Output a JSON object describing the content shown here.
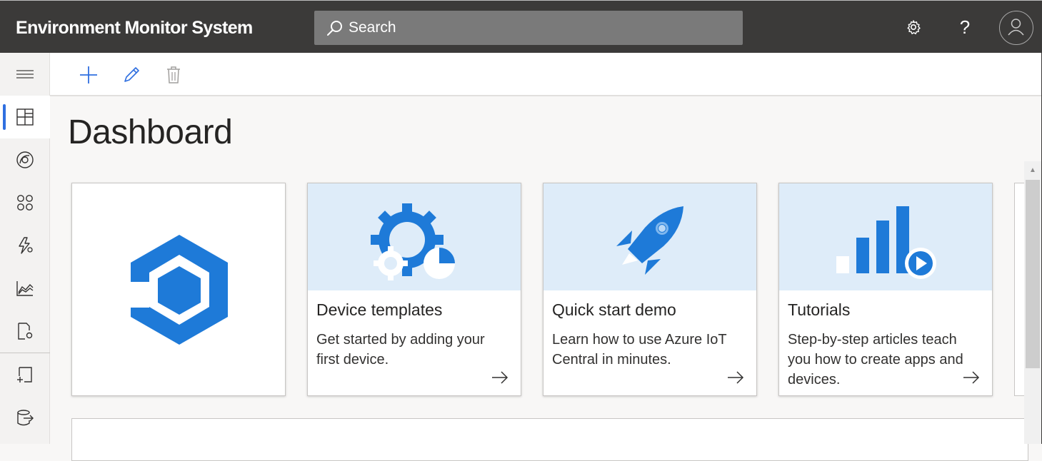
{
  "app": {
    "title": "Environment Monitor System"
  },
  "search": {
    "placeholder": "Search"
  },
  "header_icons": [
    "gear-icon",
    "help-icon",
    "avatar-icon"
  ],
  "help_glyph": "?",
  "nav": {
    "items": [
      {
        "name": "menu-icon"
      },
      {
        "name": "dashboard-icon",
        "active": true
      },
      {
        "name": "devices-icon"
      },
      {
        "name": "device-groups-icon"
      },
      {
        "name": "rules-icon"
      },
      {
        "name": "analytics-icon"
      },
      {
        "name": "jobs-icon"
      },
      {
        "name": "device-templates-icon"
      },
      {
        "name": "data-export-icon"
      }
    ]
  },
  "toolbar": {
    "buttons": [
      "add-icon",
      "edit-icon",
      "delete-icon"
    ]
  },
  "page": {
    "title": "Dashboard"
  },
  "cards": [
    {
      "name": "iot-central-logo-card",
      "title": "",
      "description": ""
    },
    {
      "name": "device-templates-card",
      "title": "Device templates",
      "description": "Get started by adding your first device."
    },
    {
      "name": "quick-start-demo-card",
      "title": "Quick start demo",
      "description": "Learn how to use Azure IoT Central in minutes."
    },
    {
      "name": "tutorials-card",
      "title": "Tutorials",
      "description": "Step-by-step articles teach you how to create apps and devices."
    }
  ],
  "colors": {
    "topbar": "#3b3a39",
    "accent": "#2f6fe0",
    "hero_bg": "#deecf9",
    "logo_blue": "#1e7ad8"
  }
}
